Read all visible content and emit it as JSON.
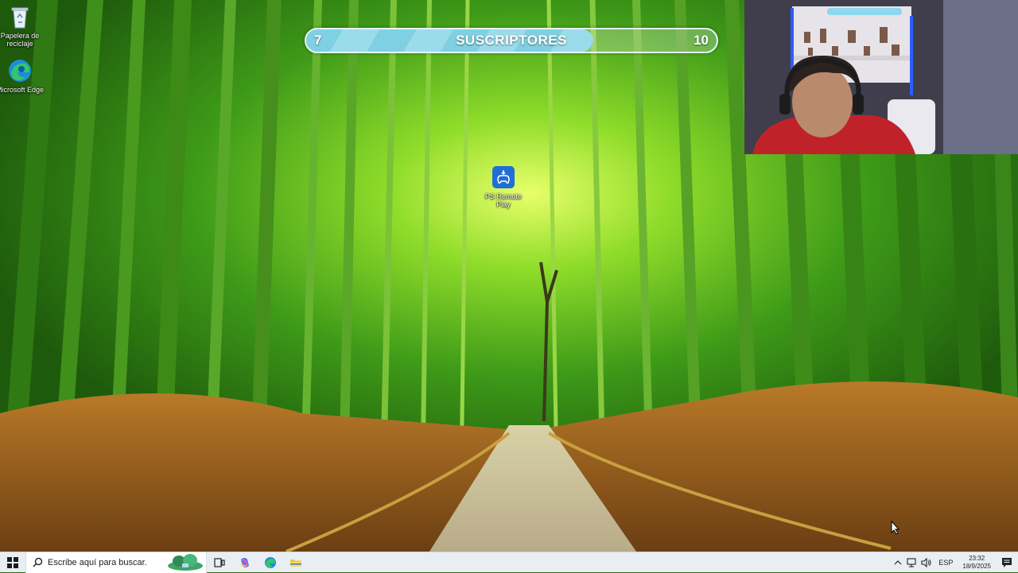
{
  "desktop": {
    "icons": [
      {
        "label": "Papelera de reciclaje",
        "icon": "recycle-bin-icon"
      },
      {
        "label": "Microsoft Edge",
        "icon": "edge-icon"
      },
      {
        "label": "PS Remote Play",
        "icon": "ps-remote-play-icon"
      }
    ]
  },
  "goal_bar": {
    "current": "7",
    "title": "SUSCRIPTORES",
    "target": "10",
    "progress": 0.7
  },
  "taskbar": {
    "search_placeholder": "Escribe aquí para buscar.",
    "apps": [
      "task-view-icon",
      "copilot-icon",
      "edge-icon",
      "file-explorer-icon"
    ],
    "language": "ESP",
    "time": "23:32",
    "date": "18/9/2025"
  },
  "colors": {
    "goal_fill": "#7fd0e2",
    "taskbar_bg": "#e9eef3",
    "wallpaper_green": "#4fb81a"
  }
}
